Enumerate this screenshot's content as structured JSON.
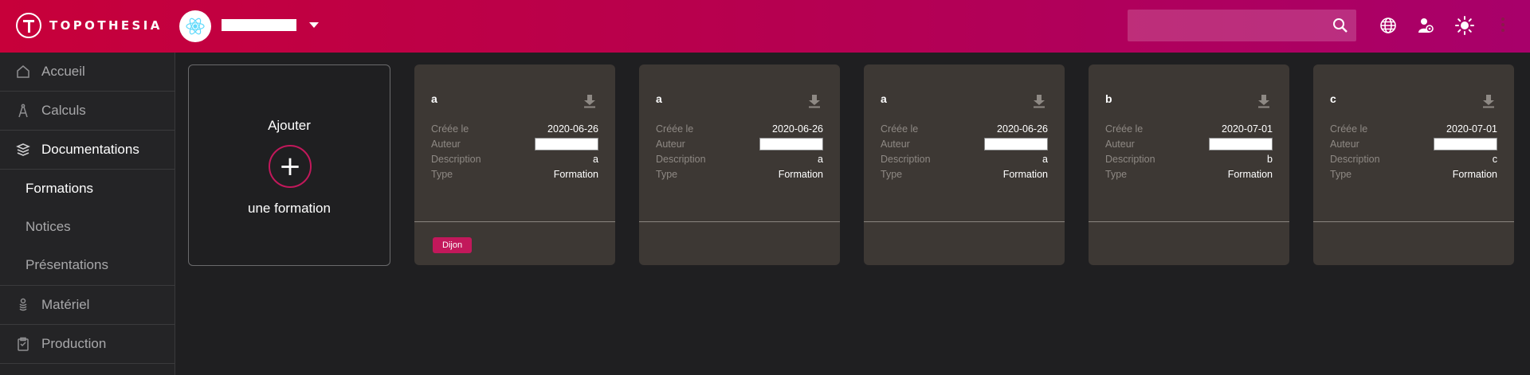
{
  "app": {
    "logo_text": "TOPOTHESIA"
  },
  "header": {
    "search_placeholder": "",
    "icons": [
      "search-icon",
      "globe-icon",
      "user-gear-icon",
      "sun-icon",
      "more-vert-icon"
    ]
  },
  "sidebar": {
    "items": [
      {
        "label": "Accueil",
        "icon": "home-icon"
      },
      {
        "label": "Calculs",
        "icon": "compass-icon"
      },
      {
        "label": "Documentations",
        "icon": "stack-icon"
      },
      {
        "label": "Matériel",
        "icon": "rope-icon"
      },
      {
        "label": "Production",
        "icon": "clipboard-icon"
      }
    ],
    "subitems": [
      {
        "label": "Formations"
      },
      {
        "label": "Notices"
      },
      {
        "label": "Présentations"
      }
    ]
  },
  "add_card": {
    "top": "Ajouter",
    "plus": "+",
    "bottom": "une formation"
  },
  "cards": [
    {
      "title": "a",
      "created_label": "Créée le",
      "created": "2020-06-26",
      "author_label": "Auteur",
      "desc_label": "Description",
      "desc": "a",
      "type_label": "Type",
      "type": "Formation",
      "tag": "Dijon"
    },
    {
      "title": "a",
      "created_label": "Créée le",
      "created": "2020-06-26",
      "author_label": "Auteur",
      "desc_label": "Description",
      "desc": "a",
      "type_label": "Type",
      "type": "Formation",
      "tag": ""
    },
    {
      "title": "a",
      "created_label": "Créée le",
      "created": "2020-06-26",
      "author_label": "Auteur",
      "desc_label": "Description",
      "desc": "a",
      "type_label": "Type",
      "type": "Formation",
      "tag": ""
    },
    {
      "title": "b",
      "created_label": "Créée le",
      "created": "2020-07-01",
      "author_label": "Auteur",
      "desc_label": "Description",
      "desc": "b",
      "type_label": "Type",
      "type": "Formation",
      "tag": ""
    },
    {
      "title": "c",
      "created_label": "Créée le",
      "created": "2020-07-01",
      "author_label": "Auteur",
      "desc_label": "Description",
      "desc": "c",
      "type_label": "Type",
      "type": "Formation",
      "tag": ""
    }
  ],
  "colors": {
    "accent": "#c2185b",
    "card_bg": "#3d3834",
    "page_bg": "#1f1f21"
  }
}
